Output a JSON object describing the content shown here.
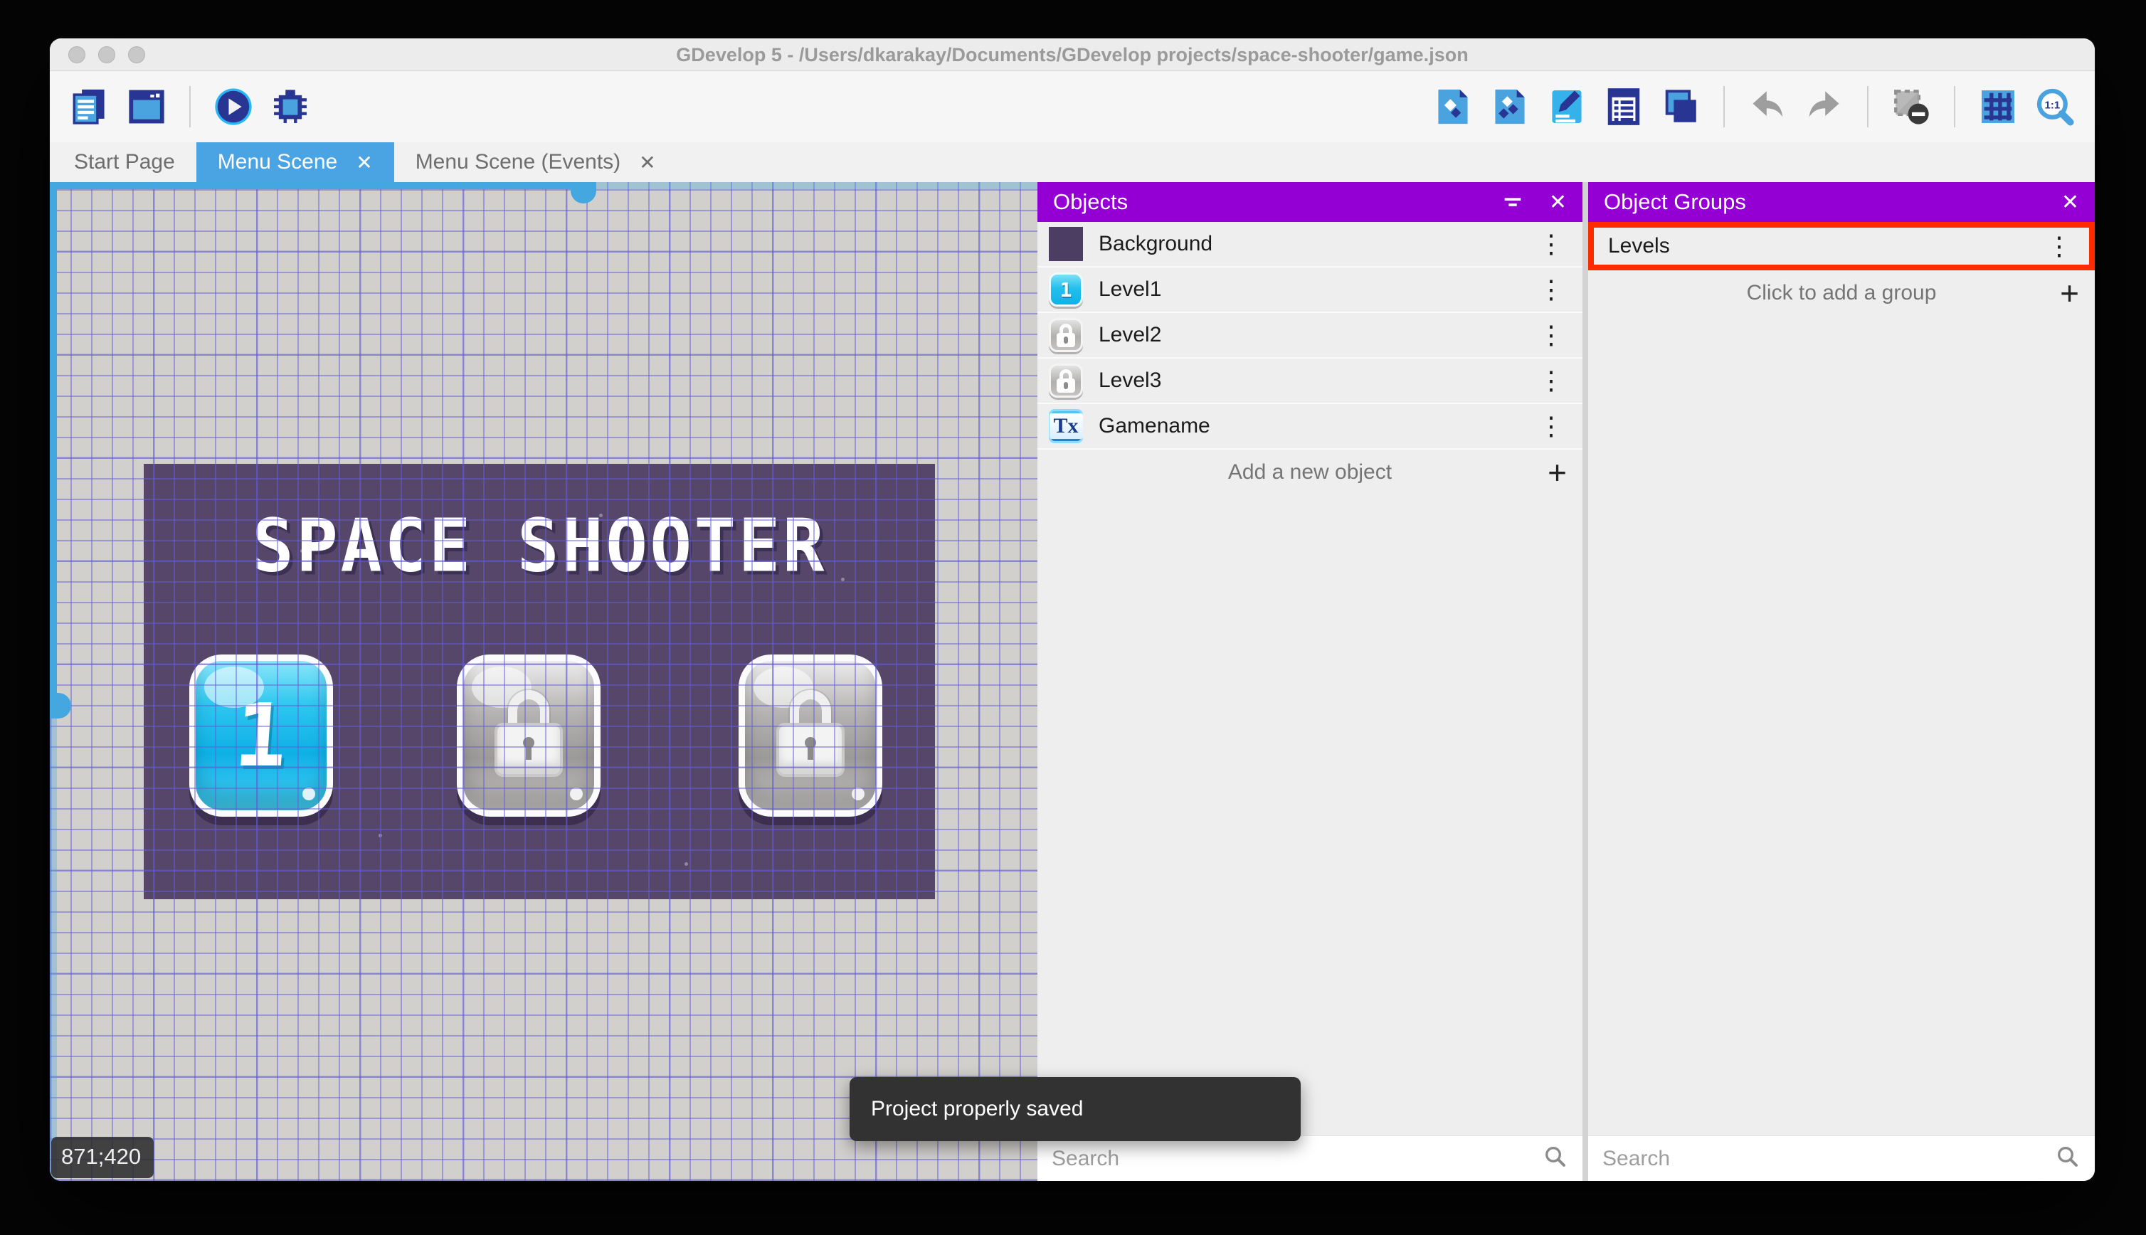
{
  "window": {
    "title": "GDevelop 5 - /Users/dkarakay/Documents/GDevelop projects/space-shooter/game.json"
  },
  "tabs": [
    {
      "label": "Start Page"
    },
    {
      "label": "Menu Scene",
      "active": true
    },
    {
      "label": "Menu Scene (Events)"
    }
  ],
  "toolbar": {
    "left_icons": [
      "project-manager-icon",
      "scene-window-icon",
      "play-preview-icon",
      "debug-icon"
    ],
    "right_icons": [
      "objects-editor-icon",
      "object-groups-editor-icon",
      "properties-icon",
      "instances-list-icon",
      "layers-icon",
      "undo-icon",
      "redo-icon",
      "window-mask-icon",
      "grid-icon",
      "zoom-1to1-icon"
    ]
  },
  "canvas": {
    "coordinates": "871;420",
    "scene": {
      "title": "SPACE SHOOTER",
      "buttons": [
        {
          "label": "1",
          "state": "unlocked"
        },
        {
          "label": "",
          "state": "locked"
        },
        {
          "label": "",
          "state": "locked"
        }
      ]
    }
  },
  "objects_panel": {
    "title": "Objects",
    "items": [
      {
        "name": "Background"
      },
      {
        "name": "Level1"
      },
      {
        "name": "Level2"
      },
      {
        "name": "Level3"
      },
      {
        "name": "Gamename"
      }
    ],
    "add_label": "Add a new object",
    "search_placeholder": "Search"
  },
  "groups_panel": {
    "title": "Object Groups",
    "items": [
      {
        "name": "Levels",
        "highlighted": true
      }
    ],
    "add_label": "Click to add a group",
    "search_placeholder": "Search"
  },
  "toast": {
    "message": "Project properly saved"
  },
  "icons": {
    "close": "✕",
    "plus": "+",
    "kebab": "⋮"
  },
  "colors": {
    "accent_blue": "#4aa3e2",
    "panel_purple": "#9400d3",
    "highlight_red": "#ff2b00",
    "scene_purple": "#564669"
  }
}
